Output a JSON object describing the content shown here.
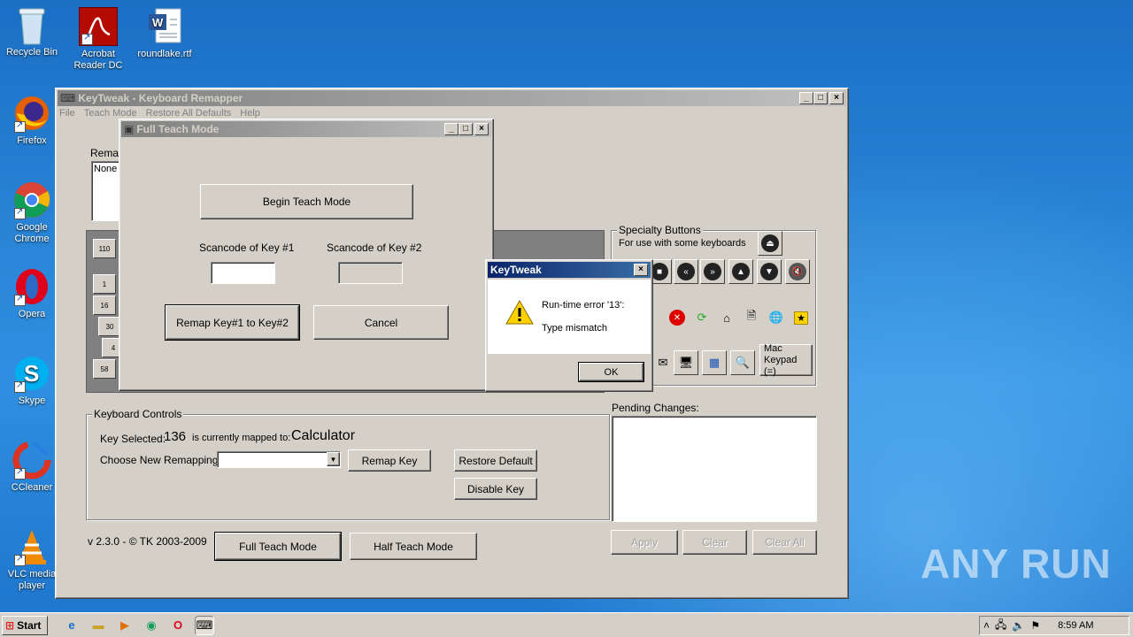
{
  "desktop_icons": [
    {
      "label": "Recycle Bin",
      "icon": "recycle-bin-icon"
    },
    {
      "label": "Acrobat Reader DC",
      "icon": "acrobat-icon"
    },
    {
      "label": "roundlake.rtf",
      "icon": "word-document-icon"
    },
    {
      "label": "Firefox",
      "icon": "firefox-icon"
    },
    {
      "label": "Google Chrome",
      "icon": "chrome-icon"
    },
    {
      "label": "Opera",
      "icon": "opera-icon"
    },
    {
      "label": "Skype",
      "icon": "skype-icon"
    },
    {
      "label": "CCleaner",
      "icon": "ccleaner-icon"
    },
    {
      "label": "VLC media player",
      "icon": "vlc-icon"
    }
  ],
  "main_window": {
    "title": "KeyTweak -  Keyboard Remapper",
    "menu": [
      "File",
      "Teach Mode",
      "Restore All Defaults",
      "Help"
    ],
    "remap_label": "Remap",
    "remap_list": "None",
    "keys": [
      "110",
      "1",
      "16",
      "30",
      "4",
      "58"
    ],
    "specialty": {
      "title": "Specialty Buttons",
      "subtitle": "For use with some keyboards",
      "mac_keypad": "Mac Keypad (=)"
    },
    "keyboard_controls": {
      "title": "Keyboard Controls",
      "key_selected_label": "Key Selected:",
      "key_selected_value": "136",
      "mapped_to_label": "is currently mapped to:",
      "mapped_to_value": "Calculator",
      "choose_label": "Choose New Remapping",
      "remap_key": "Remap Key",
      "restore_default": "Restore Default",
      "disable_key": "Disable Key"
    },
    "pending_label": "Pending Changes:",
    "version": "v 2.3.0 - © TK 2003-2009",
    "full_teach": "Full Teach Mode",
    "half_teach": "Half Teach Mode",
    "apply": "Apply",
    "clear": "Clear",
    "clear_all": "Clear All"
  },
  "teach_window": {
    "title": "Full Teach Mode",
    "begin": "Begin Teach Mode",
    "scancode1": "Scancode of Key #1",
    "scancode2": "Scancode of Key #2",
    "remap": "Remap Key#1 to Key#2",
    "cancel": "Cancel"
  },
  "error_dialog": {
    "title": "KeyTweak",
    "line1": "Run-time error '13':",
    "line2": "Type mismatch",
    "ok": "OK"
  },
  "taskbar": {
    "start": "Start",
    "time": "8:59 AM"
  },
  "watermark": "ANY RUN"
}
